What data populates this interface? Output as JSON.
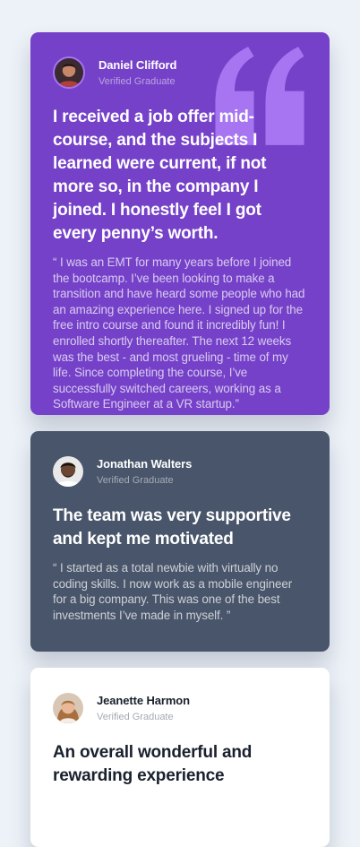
{
  "testimonials": [
    {
      "name": "Daniel Clifford",
      "role": "Verified Graduate",
      "headline": "I received a job offer mid-course, and the subjects I learned were current, if not more so, in the company I joined. I honestly feel I got every penny’s worth.",
      "body": "“ I was an EMT for many years before I joined the bootcamp. I’ve been looking to make a transition and have heard some people who had an amazing experience here. I signed up for the free intro course and found it incredibly fun! I enrolled shortly thereafter. The next 12 weeks was the best - and most grueling - time of my life. Since completing the course, I’ve successfully switched careers, working as a Software Engineer at a VR startup.”",
      "avatar_icon": "avatar-daniel",
      "background": "#7541c8"
    },
    {
      "name": "Jonathan Walters",
      "role": "Verified Graduate",
      "headline": "The team was very supportive and kept me motivated",
      "body": "“ I started as a total newbie with virtually no coding skills. I now work as a mobile engineer for a big company. This was one of the best investments I’ve made in myself. ”",
      "avatar_icon": "avatar-jonathan",
      "background": "#48556a"
    },
    {
      "name": "Jeanette Harmon",
      "role": "Verified Graduate",
      "headline": "An overall wonderful and rewarding experience",
      "body": "",
      "avatar_icon": "avatar-jeanette",
      "background": "#ffffff"
    }
  ],
  "decoration": {
    "quote_icon": "quote-icon",
    "quote_color": "#a775f1"
  },
  "page_background": "#edf2f8"
}
